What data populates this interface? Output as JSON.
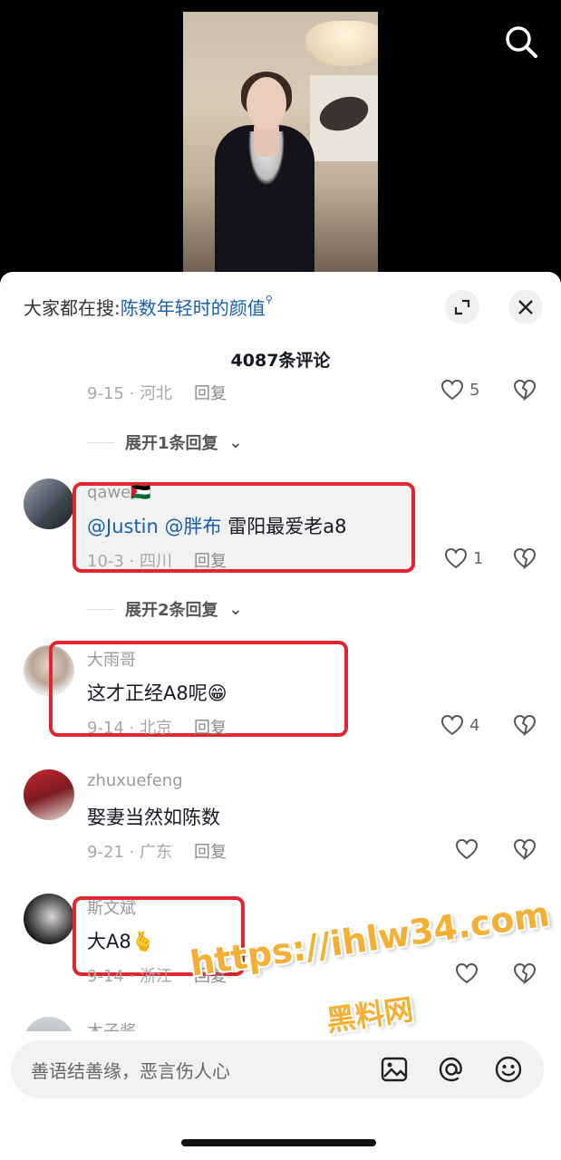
{
  "search_hint": {
    "prefix": "大家都在搜:",
    "term": "陈数年轻时的颜值"
  },
  "comment_count": "4087条评论",
  "comments": [
    {
      "date_loc": "9-15 · 河北",
      "reply": "回复",
      "likes": "5",
      "partial": true
    },
    {
      "expand_label": "展开1条回复"
    },
    {
      "username": "qawe🇵🇸",
      "mention1": "@Justin",
      "mention2": "@胖布",
      "text": "雷阳最爱老a8",
      "date_loc": "10-3 · 四川",
      "reply": "回复",
      "likes": "1"
    },
    {
      "expand_label": "展开2条回复"
    },
    {
      "username": "大雨哥",
      "text": "这才正经A8呢😁",
      "date_loc": "9-14 · 北京",
      "reply": "回复",
      "likes": "4"
    },
    {
      "username": "zhuxuefeng",
      "text": "娶妻当然如陈数",
      "date_loc": "9-21 · 广东",
      "reply": "回复",
      "likes": ""
    },
    {
      "username": "斯文斌",
      "text": "大A8🫰",
      "date_loc": "9-14 · 浙江",
      "reply": "回复",
      "likes": ""
    },
    {
      "username": "木子酱"
    }
  ],
  "input": {
    "placeholder": "善语结善缘，恶言伤人心"
  },
  "watermark": {
    "line1": "https://ihlw34.com",
    "line2": "黑料网"
  },
  "icons": {
    "search": "search-icon",
    "expand": "expand-icon",
    "close": "close-icon",
    "like": "heart-icon",
    "dislike": "broken-heart-icon",
    "image": "image-icon",
    "at": "at-icon",
    "emoji": "emoji-icon"
  },
  "colors": {
    "mention": "#1b5ea8",
    "highlight": "#e0272f",
    "watermark": "#f3b034"
  }
}
